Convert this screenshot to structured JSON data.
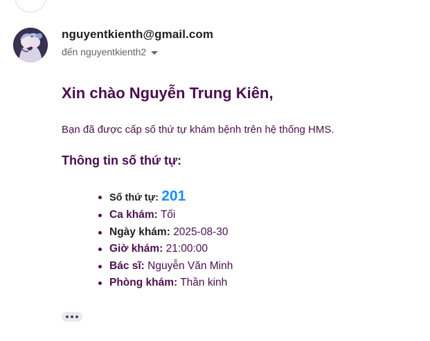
{
  "email": {
    "sender": "nguyentkienth@gmail.com",
    "recipient": "đến nguyentkienth2",
    "greeting": "Xin chào Nguyễn Trung Kiên,",
    "intro": "Bạn đã được cấp số thứ tự khám bệnh trên hệ thống HMS.",
    "subheading": "Thông tin số thứ tự:",
    "info": [
      {
        "label": "Số thứ tự:",
        "value": "201"
      },
      {
        "label": "Ca khám:",
        "value": "Tối"
      },
      {
        "label": "Ngày khám:",
        "value": "2025-08-30"
      },
      {
        "label": "Giờ khám:",
        "value": "21:00:00"
      },
      {
        "label": "Bác sĩ:",
        "value": "Nguyễn Văn Minh"
      },
      {
        "label": "Phòng khám:",
        "value": "Thần kinh"
      }
    ]
  },
  "icons": {
    "avatar": "avatar",
    "recipient_toggle": "caret-down-icon",
    "more": "more-horizontal-icon"
  },
  "colors": {
    "heading": "#4a0e4e",
    "queue_number": "#1a8cff"
  }
}
